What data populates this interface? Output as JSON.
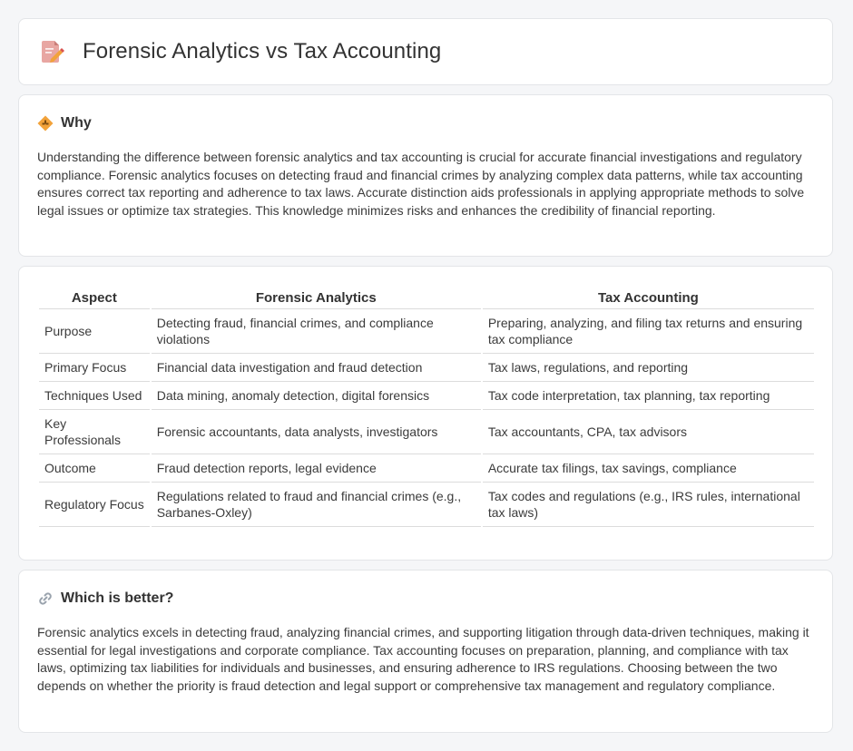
{
  "header": {
    "title": "Forensic Analytics vs Tax Accounting"
  },
  "why": {
    "title": "Why",
    "text": "Understanding the difference between forensic analytics and tax accounting is crucial for accurate financial investigations and regulatory compliance. Forensic analytics focuses on detecting fraud and financial crimes by analyzing complex data patterns, while tax accounting ensures correct tax reporting and adherence to tax laws. Accurate distinction aids professionals in applying appropriate methods to solve legal issues or optimize tax strategies. This knowledge minimizes risks and enhances the credibility of financial reporting."
  },
  "comparison": {
    "headers": [
      "Aspect",
      "Forensic Analytics",
      "Tax Accounting"
    ],
    "rows": [
      [
        "Purpose",
        "Detecting fraud, financial crimes, and compliance violations",
        "Preparing, analyzing, and filing tax returns and ensuring tax compliance"
      ],
      [
        "Primary Focus",
        "Financial data investigation and fraud detection",
        "Tax laws, regulations, and reporting"
      ],
      [
        "Techniques Used",
        "Data mining, anomaly detection, digital forensics",
        "Tax code interpretation, tax planning, tax reporting"
      ],
      [
        "Key Professionals",
        "Forensic accountants, data analysts, investigators",
        "Tax accountants, CPA, tax advisors"
      ],
      [
        "Outcome",
        "Fraud detection reports, legal evidence",
        "Accurate tax filings, tax savings, compliance"
      ],
      [
        "Regulatory Focus",
        "Regulations related to fraud and financial crimes (e.g., Sarbanes-Oxley)",
        "Tax codes and regulations (e.g., IRS rules, international tax laws)"
      ]
    ]
  },
  "better": {
    "title": "Which is better?",
    "text": "Forensic analytics excels in detecting fraud, analyzing financial crimes, and supporting litigation through data-driven techniques, making it essential for legal investigations and corporate compliance. Tax accounting focuses on preparation, planning, and compliance with tax laws, optimizing tax liabilities for individuals and businesses, and ensuring adherence to IRS regulations. Choosing between the two depends on whether the priority is fraud detection and legal support or comprehensive tax management and regulatory compliance."
  },
  "icons": {
    "title_icon": "document-pencil-icon",
    "why_icon": "diamond-sign-icon",
    "better_icon": "link-icon"
  },
  "colors": {
    "background": "#f5f6f8",
    "card": "#ffffff",
    "accent_orange": "#f2a23a",
    "text": "#3a3a3a"
  }
}
